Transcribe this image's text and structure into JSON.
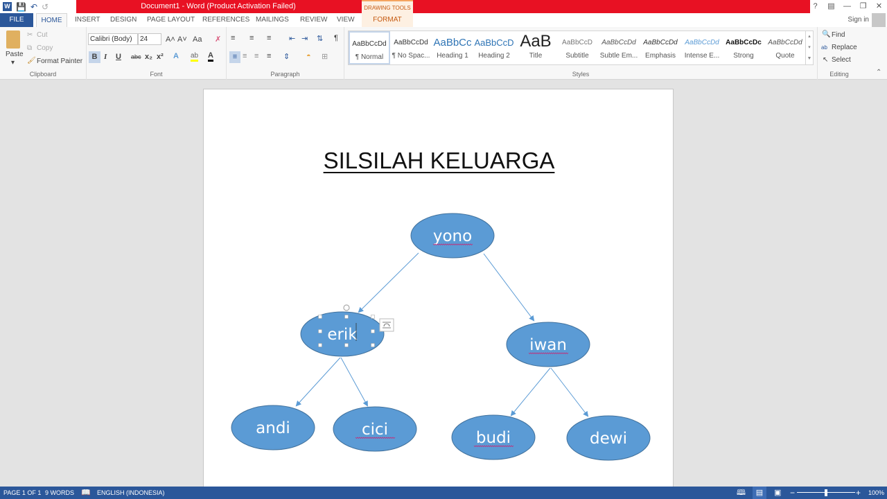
{
  "titlebar": {
    "title": "Document1 -  Word (Product Activation Failed)",
    "contextual_group": "DRAWING TOOLS",
    "qat": [
      "word-logo-icon",
      "save-icon",
      "undo-icon",
      "redo-icon"
    ],
    "window_controls": [
      "?",
      "⊡",
      "—",
      "❐",
      "✕"
    ]
  },
  "tabs": {
    "file": "FILE",
    "items": [
      "HOME",
      "INSERT",
      "DESIGN",
      "PAGE LAYOUT",
      "REFERENCES",
      "MAILINGS",
      "REVIEW",
      "VIEW"
    ],
    "format": "FORMAT",
    "signin": "Sign in"
  },
  "ribbon": {
    "clipboard": {
      "paste": "Paste",
      "cut": "Cut",
      "copy": "Copy",
      "format_painter": "Format Painter",
      "label": "Clipboard"
    },
    "font": {
      "name": "Calibri (Body)",
      "size": "24",
      "label": "Font",
      "bold": "B",
      "italic": "I",
      "underline": "U",
      "strike": "abc",
      "sub": "x₂",
      "sup": "x²",
      "grow": "A˄",
      "shrink": "A˅",
      "case": "Aa"
    },
    "paragraph": {
      "label": "Paragraph"
    },
    "styles": {
      "label": "Styles",
      "items": [
        {
          "preview": "AaBbCcDd",
          "name": "¶ Normal"
        },
        {
          "preview": "AaBbCcDd",
          "name": "¶ No Spac..."
        },
        {
          "preview": "AaBbCc",
          "name": "Heading 1"
        },
        {
          "preview": "AaBbCcD",
          "name": "Heading 2"
        },
        {
          "preview": "AaB",
          "name": "Title"
        },
        {
          "preview": "AaBbCcD",
          "name": "Subtitle"
        },
        {
          "preview": "AaBbCcDd",
          "name": "Subtle Em..."
        },
        {
          "preview": "AaBbCcDd",
          "name": "Emphasis"
        },
        {
          "preview": "AaBbCcDd",
          "name": "Intense E..."
        },
        {
          "preview": "AaBbCcDc",
          "name": "Strong"
        },
        {
          "preview": "AaBbCcDd",
          "name": "Quote"
        }
      ]
    },
    "editing": {
      "find": "Find",
      "replace": "Replace",
      "select": "Select",
      "label": "Editing"
    }
  },
  "document": {
    "heading": "SILSILAH KELUARGA",
    "nodes": {
      "yono": "yono",
      "erik": "erik",
      "iwan": "iwan",
      "andi": "andi",
      "cici": "cici",
      "budi": "budi",
      "dewi": "dewi"
    },
    "shape_fill": "#5b9bd5",
    "shape_stroke": "#41719c",
    "connector_color": "#5b9bd5"
  },
  "status": {
    "page": "PAGE 1 OF 1",
    "words": "9 WORDS",
    "language": "ENGLISH (INDONESIA)",
    "zoom": "100%",
    "zoom_slider_percent": 50
  }
}
